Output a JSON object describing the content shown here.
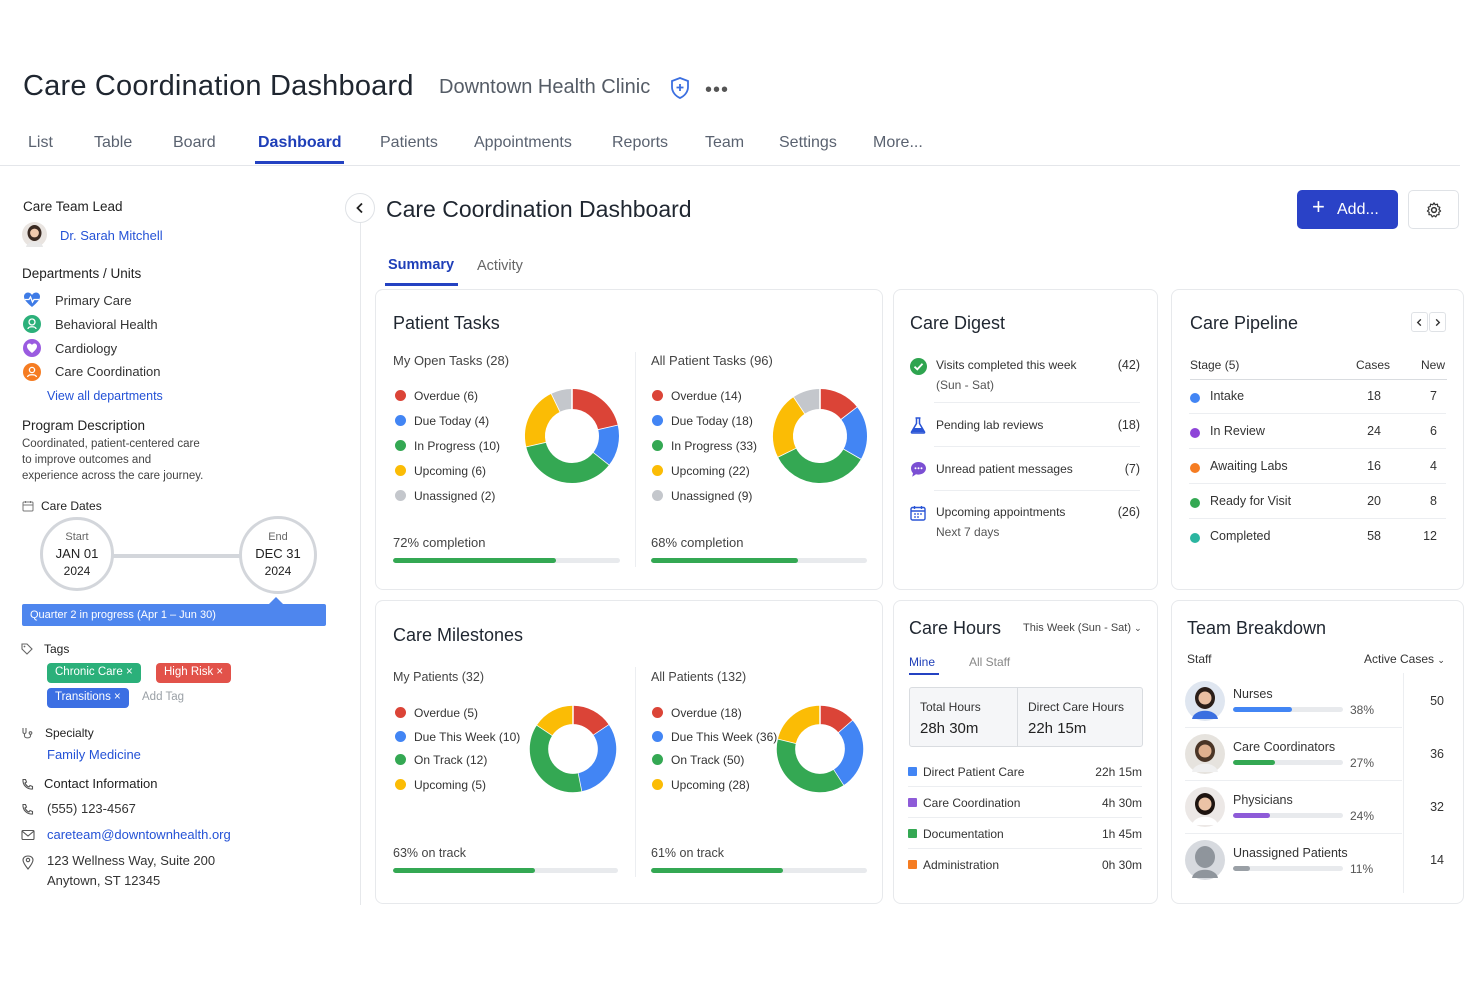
{
  "header": {
    "title": "Care Coordination Dashboard",
    "org": "Downtown Health Clinic",
    "more": "•••"
  },
  "nav": [
    "List",
    "Table",
    "Board",
    "Dashboard",
    "Patients",
    "Appointments",
    "Reports",
    "Team",
    "Settings",
    "More..."
  ],
  "sidebar": {
    "lead_heading": "Care Team Lead",
    "lead_name": "Dr. Sarah Mitchell",
    "departments_heading": "Departments / Units",
    "departments": [
      "Primary Care",
      "Behavioral Health",
      "Cardiology",
      "Care Coordination"
    ],
    "view_all": "View all departments",
    "program_heading": "Program Description",
    "program_lines": [
      "Coordinated, patient-centered care",
      "to improve outcomes and",
      "experience across the care journey."
    ],
    "dates_heading": "Care Dates",
    "start_label": "Start",
    "start_date": "JAN 01",
    "start_year": "2024",
    "end_label": "End",
    "end_date": "DEC 31",
    "end_year": "2024",
    "quarter_banner": "Quarter 2 in progress (Apr 1 – Jun 30)",
    "tags_heading": "Tags",
    "tags": [
      "Chronic Care",
      "High Risk",
      "Transitions"
    ],
    "add_tag": "Add Tag",
    "specialty_heading": "Specialty",
    "specialty": "Family Medicine",
    "contact_heading": "Contact Information",
    "phone": "(555) 123-4567",
    "email": "careteam@downtownhealth.org",
    "address1": "123 Wellness Way, Suite 200",
    "address2": "Anytown, ST 12345"
  },
  "main": {
    "title": "Care Coordination Dashboard",
    "add_button": "Add...",
    "tabs": [
      "Summary",
      "Activity"
    ]
  },
  "colors": {
    "red": "#db4437",
    "blue": "#4285f4",
    "green": "#34a853",
    "yellow": "#fbbc05",
    "gray": "#c4c7cc"
  },
  "patient_tasks": {
    "title": "Patient Tasks",
    "mine": {
      "label": "My Open Tasks (28)",
      "items": [
        {
          "label": "Overdue (6)",
          "value": 6,
          "color": "#db4437"
        },
        {
          "label": "Due Today (4)",
          "value": 4,
          "color": "#4285f4"
        },
        {
          "label": "In Progress (10)",
          "value": 10,
          "color": "#34a853"
        },
        {
          "label": "Upcoming (6)",
          "value": 6,
          "color": "#fbbc05"
        },
        {
          "label": "Unassigned (2)",
          "value": 2,
          "color": "#c4c7cc"
        }
      ],
      "completion_label": "72% completion",
      "completion": 0.72
    },
    "all": {
      "label": "All Patient Tasks (96)",
      "items": [
        {
          "label": "Overdue (14)",
          "value": 14,
          "color": "#db4437"
        },
        {
          "label": "Due Today (18)",
          "value": 18,
          "color": "#4285f4"
        },
        {
          "label": "In Progress (33)",
          "value": 33,
          "color": "#34a853"
        },
        {
          "label": "Upcoming (22)",
          "value": 22,
          "color": "#fbbc05"
        },
        {
          "label": "Unassigned (9)",
          "value": 9,
          "color": "#c4c7cc"
        }
      ],
      "completion_label": "68% completion",
      "completion": 0.68
    }
  },
  "care_digest": {
    "title": "Care Digest",
    "items": [
      {
        "label": "Visits completed this week",
        "sub": "(Sun - Sat)",
        "count": "(42)"
      },
      {
        "label": "Pending lab reviews",
        "sub": "",
        "count": "(18)"
      },
      {
        "label": "Unread patient messages",
        "sub": "",
        "count": "(7)"
      },
      {
        "label": "Upcoming appointments",
        "sub": "Next 7 days",
        "count": "(26)"
      }
    ]
  },
  "care_pipeline": {
    "title": "Care Pipeline",
    "col_stage": "Stage (5)",
    "col_cases": "Cases",
    "col_new": "New",
    "rows": [
      {
        "stage": "Intake",
        "cases": "18",
        "new": "7",
        "color": "#4285f4"
      },
      {
        "stage": "In Review",
        "cases": "24",
        "new": "6",
        "color": "#8e44d8"
      },
      {
        "stage": "Awaiting Labs",
        "cases": "16",
        "new": "4",
        "color": "#f57c22"
      },
      {
        "stage": "Ready for Visit",
        "cases": "20",
        "new": "8",
        "color": "#34a853"
      },
      {
        "stage": "Completed",
        "cases": "58",
        "new": "12",
        "color": "#2bb5a0"
      }
    ]
  },
  "care_milestones": {
    "title": "Care Milestones",
    "mine": {
      "label": "My Patients (32)",
      "items": [
        {
          "label": "Overdue (5)",
          "value": 5,
          "color": "#db4437"
        },
        {
          "label": "Due This Week (10)",
          "value": 10,
          "color": "#4285f4"
        },
        {
          "label": "On Track (12)",
          "value": 12,
          "color": "#34a853"
        },
        {
          "label": "Upcoming (5)",
          "value": 5,
          "color": "#fbbc05"
        }
      ],
      "track_label": "63% on track",
      "track": 0.63
    },
    "all": {
      "label": "All Patients (132)",
      "items": [
        {
          "label": "Overdue (18)",
          "value": 18,
          "color": "#db4437"
        },
        {
          "label": "Due This Week (36)",
          "value": 36,
          "color": "#4285f4"
        },
        {
          "label": "On Track (50)",
          "value": 50,
          "color": "#34a853"
        },
        {
          "label": "Upcoming (28)",
          "value": 28,
          "color": "#fbbc05"
        }
      ],
      "track_label": "61% on track",
      "track": 0.61
    }
  },
  "care_hours": {
    "title": "Care Hours",
    "range": "This Week (Sun - Sat)",
    "tabs": [
      "Mine",
      "All Staff"
    ],
    "total_label": "Total Hours",
    "total_value": "28h 30m",
    "direct_label": "Direct Care Hours",
    "direct_value": "22h 15m",
    "rows": [
      {
        "label": "Direct Patient Care",
        "value": "22h 15m",
        "color": "#4285f4"
      },
      {
        "label": "Care Coordination",
        "value": "4h 30m",
        "color": "#8e5bd8"
      },
      {
        "label": "Documentation",
        "value": "1h 45m",
        "color": "#34a853"
      },
      {
        "label": "Administration",
        "value": "0h 30m",
        "color": "#f57c22"
      }
    ]
  },
  "team_breakdown": {
    "title": "Team Breakdown",
    "staff_label": "Staff",
    "filter": "Active Cases",
    "rows": [
      {
        "name": "Nurses",
        "pct_label": "38%",
        "pct": 0.38,
        "count": "50",
        "color": "#4285f4"
      },
      {
        "name": "Care Coordinators",
        "pct_label": "27%",
        "pct": 0.27,
        "count": "36",
        "color": "#34a853"
      },
      {
        "name": "Physicians",
        "pct_label": "24%",
        "pct": 0.24,
        "count": "32",
        "color": "#8e5bd8"
      },
      {
        "name": "Unassigned Patients",
        "pct_label": "11%",
        "pct": 0.11,
        "count": "14",
        "color": "#9aa0a6"
      }
    ]
  }
}
